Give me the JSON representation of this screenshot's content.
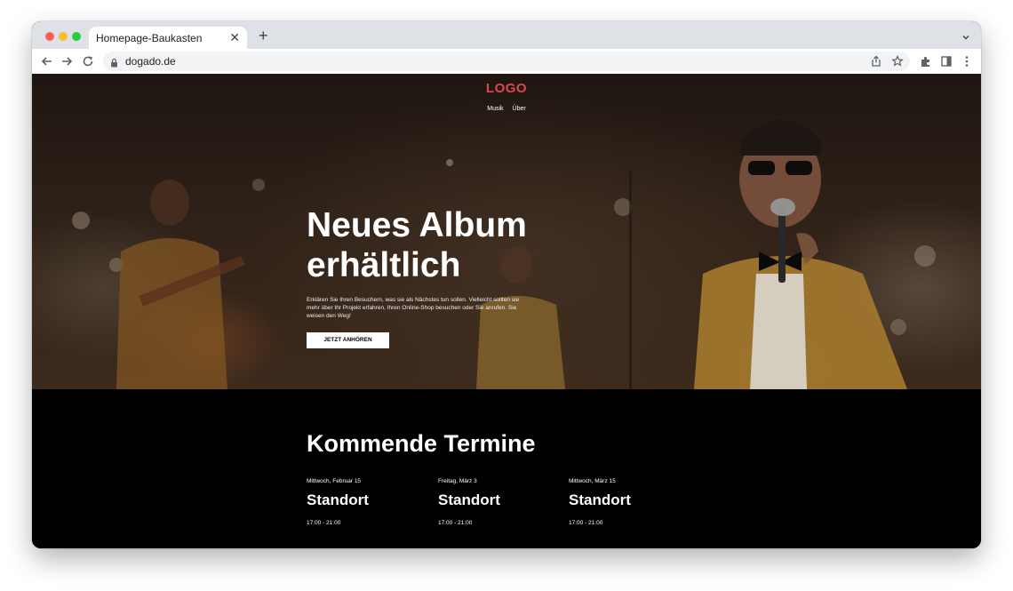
{
  "browser": {
    "tab_title": "Homepage-Baukasten",
    "url": "dogado.de"
  },
  "site": {
    "logo": "LOGO",
    "nav": [
      "Musik",
      "Über"
    ],
    "hero": {
      "title": "Neues Album erhältlich",
      "description": "Erklären Sie Ihren Besuchern, was sie als Nächstes tun sollen. Vielleicht sollten sie mehr über Ihr Projekt erfahren, Ihren Online-Shop besuchen oder Sie anrufen. Sie weisen den Weg!",
      "button": "JETZT ANHÖREN"
    },
    "events": {
      "title": "Kommende Termine",
      "items": [
        {
          "date": "Mittwoch, Februar 15",
          "location": "Standort",
          "time": "17:00 - 21:00"
        },
        {
          "date": "Freitag, März 3",
          "location": "Standort",
          "time": "17:00 - 21:00"
        },
        {
          "date": "Mittwoch, März 15",
          "location": "Standort",
          "time": "17:00 - 21:00"
        }
      ]
    }
  },
  "colors": {
    "logo": "#e0474c",
    "hero_overlay": "#2e2118",
    "events_bg": "#000000",
    "button_bg": "#ffffff"
  },
  "icons": [
    "back-icon",
    "forward-icon",
    "reload-icon",
    "lock-icon",
    "share-icon",
    "bookmark-star-icon",
    "extensions-icon",
    "side-panel-icon",
    "menu-kebab-icon",
    "close-icon",
    "plus-icon",
    "chevron-down-icon"
  ]
}
